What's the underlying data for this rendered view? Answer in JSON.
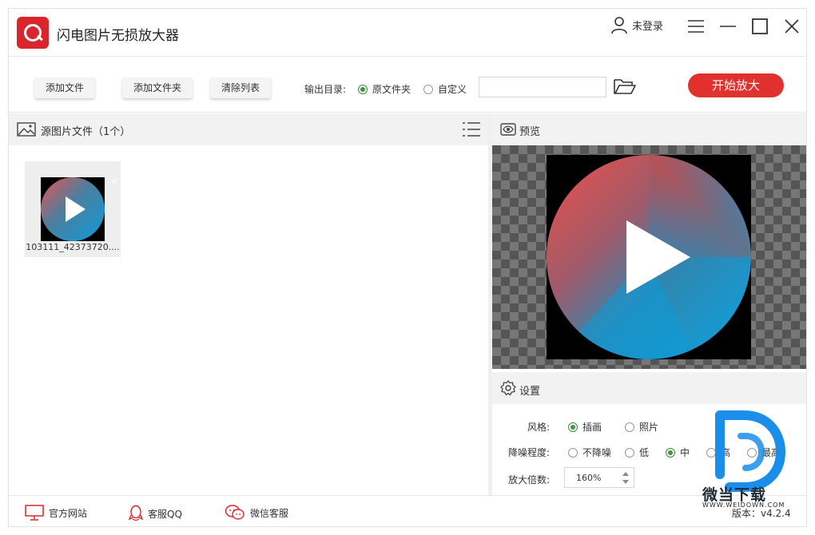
{
  "app": {
    "title": "闪电图片无损放大器"
  },
  "user": {
    "label": "未登录"
  },
  "toolbar": {
    "add_file": "添加文件",
    "add_folder": "添加文件夹",
    "clear_list": "清除列表",
    "output_label": "输出目录:",
    "output_options": [
      {
        "label": "原文件夹",
        "selected": true
      },
      {
        "label": "自定义",
        "selected": false
      }
    ],
    "path_value": "",
    "start_label": "开始放大"
  },
  "source": {
    "title": "源图片文件（1个）",
    "files": [
      {
        "name": "103111_42373720...."
      }
    ]
  },
  "preview": {
    "title": "预览"
  },
  "settings": {
    "title": "设置",
    "style_label": "风格:",
    "style_options": [
      {
        "label": "插画",
        "selected": true
      },
      {
        "label": "照片",
        "selected": false
      }
    ],
    "denoise_label": "降噪程度:",
    "denoise_options": [
      {
        "label": "不降噪",
        "selected": false
      },
      {
        "label": "低",
        "selected": false
      },
      {
        "label": "中",
        "selected": true
      },
      {
        "label": "高",
        "selected": false
      },
      {
        "label": "最高",
        "selected": false
      }
    ],
    "scale_label": "放大倍数:",
    "scale_value": "160%"
  },
  "footer": {
    "website": "官方网站",
    "qq": "客服QQ",
    "wechat": "微信客服",
    "version": "版本：v4.2.4"
  },
  "watermark": {
    "name": "微当下载",
    "url": "WWW.WEIDOWN.COM"
  },
  "colors": {
    "accent": "#e0312e",
    "radio_selected": "#3a9a3a",
    "watermark_blue": "#1a8ee8"
  }
}
